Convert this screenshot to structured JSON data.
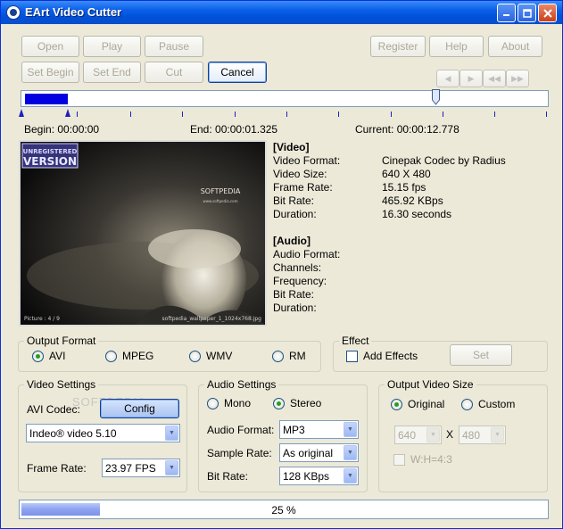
{
  "window": {
    "title": "EArt Video Cutter"
  },
  "toolbar": {
    "open": "Open",
    "play": "Play",
    "pause": "Pause",
    "set_begin": "Set Begin",
    "set_end": "Set End",
    "cut": "Cut",
    "cancel": "Cancel",
    "register": "Register",
    "help": "Help",
    "about": "About"
  },
  "timeline": {
    "begin_label": "Begin:",
    "begin": "00:00:00",
    "end_label": "End:",
    "end": "00:00:01.325",
    "current_label": "Current:",
    "current": "00:00:12.778",
    "position_fraction": 0.78
  },
  "preview": {
    "watermark_top": "UNREGISTERED",
    "watermark_bottom": "VERSION",
    "brand": "SOFTPEDIA",
    "brand_sub": "www.softpedia.com",
    "picture_caption": "Picture : 4 / 9",
    "file_caption": "softpedia_wallpaper_1_1024x768.jpg"
  },
  "video_info": {
    "heading": "[Video]",
    "rows": [
      {
        "label": "Video Format:",
        "value": "Cinepak Codec by Radius"
      },
      {
        "label": "Video Size:",
        "value": "640 X 480"
      },
      {
        "label": "Frame Rate:",
        "value": "15.15 fps"
      },
      {
        "label": "Bit Rate:",
        "value": "465.92 KBps"
      },
      {
        "label": "Duration:",
        "value": "16.30 seconds"
      }
    ]
  },
  "audio_info": {
    "heading": "[Audio]",
    "rows": [
      {
        "label": "Audio Format:",
        "value": ""
      },
      {
        "label": "Channels:",
        "value": ""
      },
      {
        "label": "Frequency:",
        "value": ""
      },
      {
        "label": "Bit Rate:",
        "value": ""
      },
      {
        "label": "Duration:",
        "value": ""
      }
    ]
  },
  "output_format": {
    "legend": "Output Format",
    "options": [
      "AVI",
      "MPEG",
      "WMV",
      "RM"
    ],
    "selected": "AVI"
  },
  "effect": {
    "legend": "Effect",
    "add_effects": "Add Effects",
    "set": "Set"
  },
  "video_settings": {
    "legend": "Video Settings",
    "codec_label": "AVI Codec:",
    "config": "Config",
    "watermark": "SOFTPEDIA",
    "codec_value": "Indeo® video 5.10",
    "frame_rate_label": "Frame Rate:",
    "frame_rate_value": "23.97 FPS"
  },
  "audio_settings": {
    "legend": "Audio Settings",
    "mono": "Mono",
    "stereo": "Stereo",
    "selected": "Stereo",
    "format_label": "Audio Format:",
    "format_value": "MP3",
    "sample_label": "Sample Rate:",
    "sample_value": "As original",
    "bitrate_label": "Bit Rate:",
    "bitrate_value": "128 KBps"
  },
  "output_size": {
    "legend": "Output Video Size",
    "original": "Original",
    "custom": "Custom",
    "selected": "Original",
    "width": "640",
    "x_label": "X",
    "height": "480",
    "ratio_label": "W:H=4:3"
  },
  "progress": {
    "text": "25 %",
    "fraction": 0.25
  },
  "colors": {
    "accent": "#0a5fe8",
    "selection": "#0000e0",
    "progress": "#8ea3f0"
  }
}
